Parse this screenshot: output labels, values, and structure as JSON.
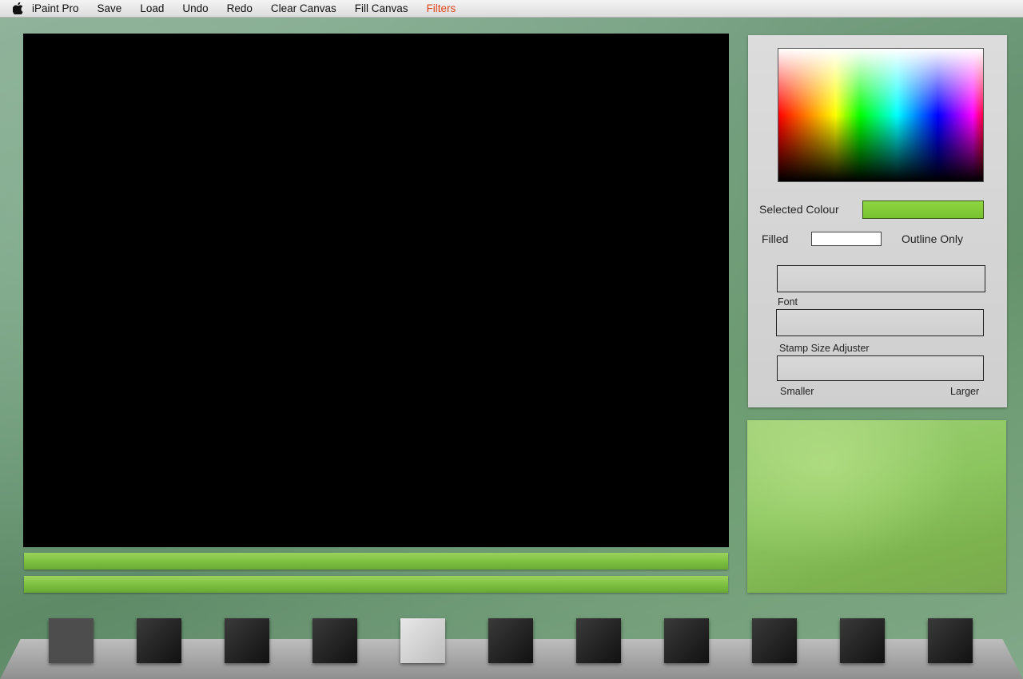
{
  "menubar": {
    "items": [
      {
        "label": "iPaint Pro"
      },
      {
        "label": "Save"
      },
      {
        "label": "Load"
      },
      {
        "label": "Undo"
      },
      {
        "label": "Redo"
      },
      {
        "label": "Clear Canvas"
      },
      {
        "label": "Fill Canvas"
      },
      {
        "label": "Filters"
      }
    ],
    "active_color": "#e0451c"
  },
  "panel": {
    "selected_colour_label": "Selected Colour",
    "selected_colour": "#80c838",
    "filled_label": "Filled",
    "outline_label": "Outline Only",
    "font_label": "Font",
    "stamp_label": "Stamp Size Adjuster",
    "smaller_label": "Smaller",
    "larger_label": "Larger"
  },
  "canvas": {
    "background": "#000000"
  },
  "toolbar": {
    "tools": [
      {
        "name": "tool-1"
      },
      {
        "name": "tool-2"
      },
      {
        "name": "tool-3"
      },
      {
        "name": "tool-4"
      },
      {
        "name": "tool-5"
      },
      {
        "name": "tool-6"
      },
      {
        "name": "tool-7"
      },
      {
        "name": "tool-8"
      },
      {
        "name": "tool-9"
      },
      {
        "name": "tool-10"
      },
      {
        "name": "tool-11"
      }
    ]
  }
}
